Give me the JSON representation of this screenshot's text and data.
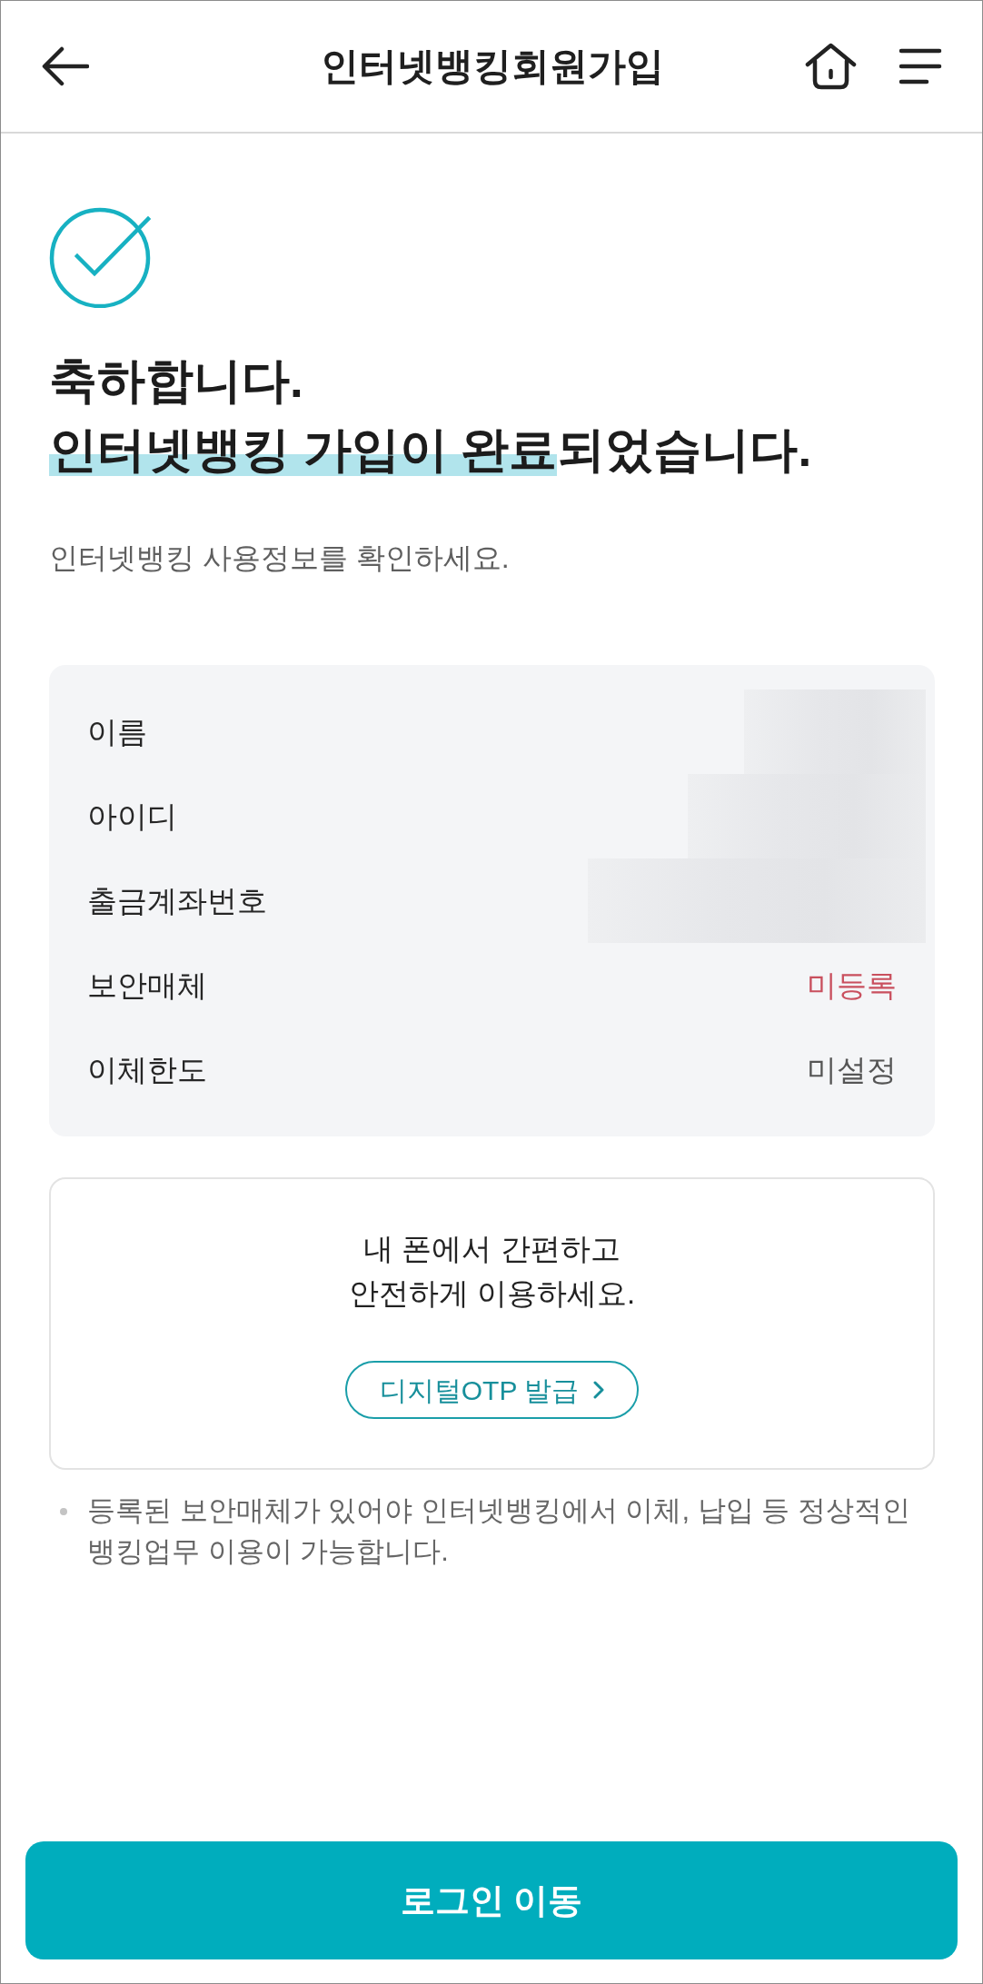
{
  "header": {
    "title": "인터넷뱅킹회원가입"
  },
  "success": {
    "heading": [
      "축하합니다.",
      "**인터넷뱅킹 가입이 완료**되었습니다."
    ],
    "subtitle": "인터넷뱅킹 사용정보를 확인하세요."
  },
  "info": [
    {
      "label": "이름",
      "kind": "masked"
    },
    {
      "label": "아이디",
      "kind": "masked"
    },
    {
      "label": "출금계좌번호",
      "kind": "masked"
    },
    {
      "label": "보안매체",
      "kind": "text",
      "value": "미등록",
      "color": "#c9505e"
    },
    {
      "label": "이체한도",
      "kind": "text",
      "value": "미설정",
      "color": "#555555"
    }
  ],
  "otp_card": {
    "message": [
      "내 폰에서 간편하고",
      "안전하게 이용하세요."
    ],
    "button": "디지털OTP 발급"
  },
  "notes": [
    "등록된 보안매체가 있어야 인터넷뱅킹에서 이체, 납입 등 정상적인 뱅킹업무 이용이 가능합니다."
  ],
  "login_button": "로그인 이동"
}
